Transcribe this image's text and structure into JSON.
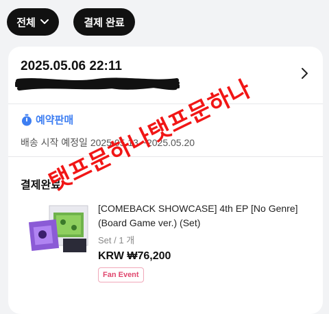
{
  "filters": {
    "all_label": "전체",
    "status_label": "결제 완료"
  },
  "order": {
    "datetime": "2025.05.06 22:11",
    "preorder_label": "예약판매",
    "ship_date": "배송 시작 예정일 2025.05.13 ~2025.05.20",
    "status": "결제완료",
    "product_name": "[COMEBACK SHOWCASE] 4th EP [No Genre] (Board Game ver.) (Set)",
    "option": "Set / 1 개",
    "price": "KRW ₩76,200",
    "badge": "Fan Event"
  },
  "watermark": "탯프문하나탯프문하나",
  "colors": {
    "accent": "#3d7ef2",
    "watermark": "#f11616",
    "badge": "#e0466d"
  },
  "icons": [
    "chevron-down-icon",
    "chevron-right-icon",
    "timer-icon"
  ]
}
